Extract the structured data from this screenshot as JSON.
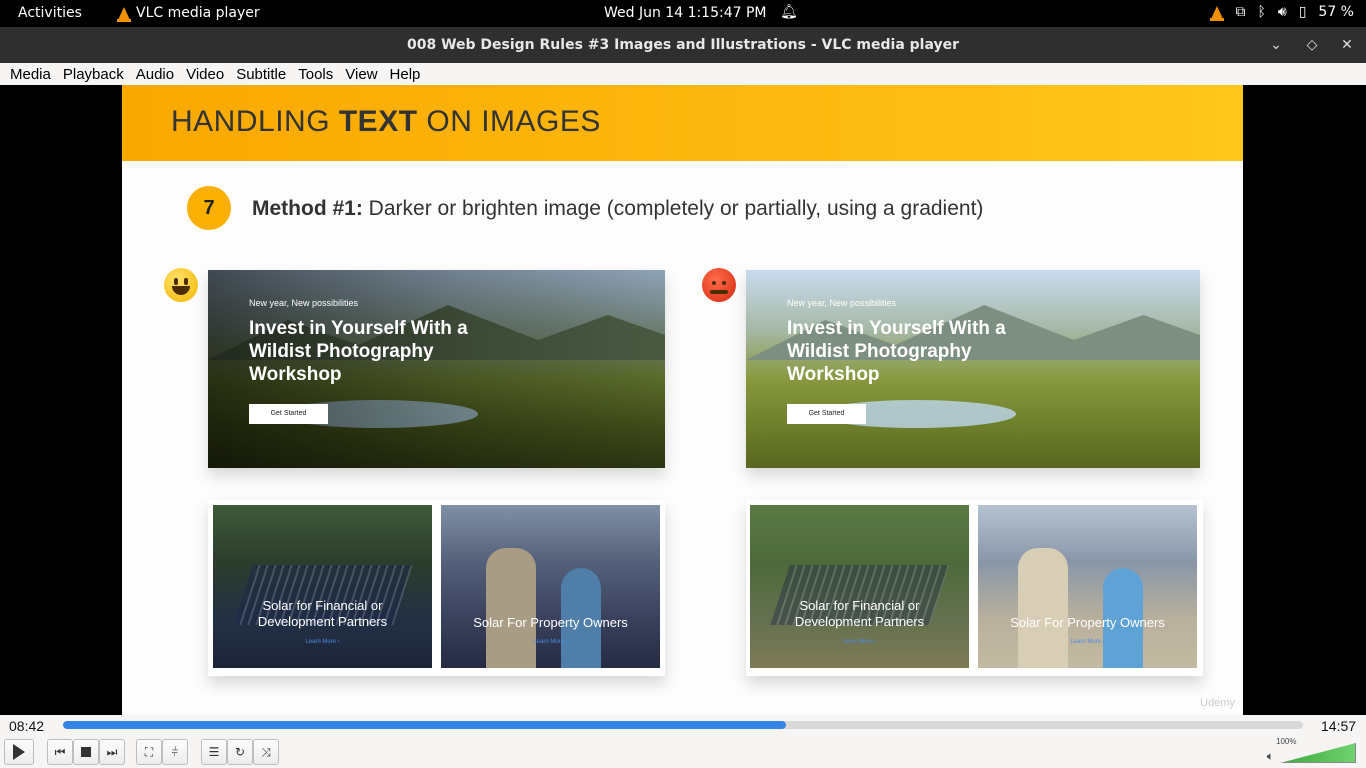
{
  "system_bar": {
    "activities": "Activities",
    "app_name": "VLC media player",
    "clock": "Wed Jun 14   1:15:47 PM",
    "battery": "57 %"
  },
  "window": {
    "title": "008 Web Design Rules #3 Images and Illustrations - VLC media player"
  },
  "menu": [
    "Media",
    "Playback",
    "Audio",
    "Video",
    "Subtitle",
    "Tools",
    "View",
    "Help"
  ],
  "slide": {
    "title_pre": "HANDLING ",
    "title_bold": "TEXT",
    "title_post": " ON IMAGES",
    "step_number": "7",
    "method_bold": "Method #1:",
    "method_text": " Darker or brighten image (completely or partially, using a gradient)",
    "good_hero": {
      "eyebrow": "New year, New possibilities",
      "headline": "Invest in Yourself With a Wildist Photography Workshop",
      "cta": "Get Started"
    },
    "bad_hero": {
      "eyebrow": "New year, New possibilities",
      "headline": "Invest in Yourself With a Wildist Photography Workshop",
      "cta": "Get Started"
    },
    "good_cards": [
      {
        "label": "Solar for Financial or Development Partners",
        "link": "Learn More  ›"
      },
      {
        "label": "Solar For Property Owners",
        "link": "Learn More  ›"
      }
    ],
    "bad_cards": [
      {
        "label": "Solar for Financial or Development Partners",
        "link": "Learn More  ›"
      },
      {
        "label": "Solar For Property Owners",
        "link": "Learn More  ›"
      }
    ],
    "watermark": "Udemy"
  },
  "player": {
    "elapsed": "08:42",
    "total": "14:57",
    "progress": 0.583,
    "volume": "100%"
  },
  "colors": {
    "accent": "#3584e4",
    "banner": "#f9a800"
  }
}
